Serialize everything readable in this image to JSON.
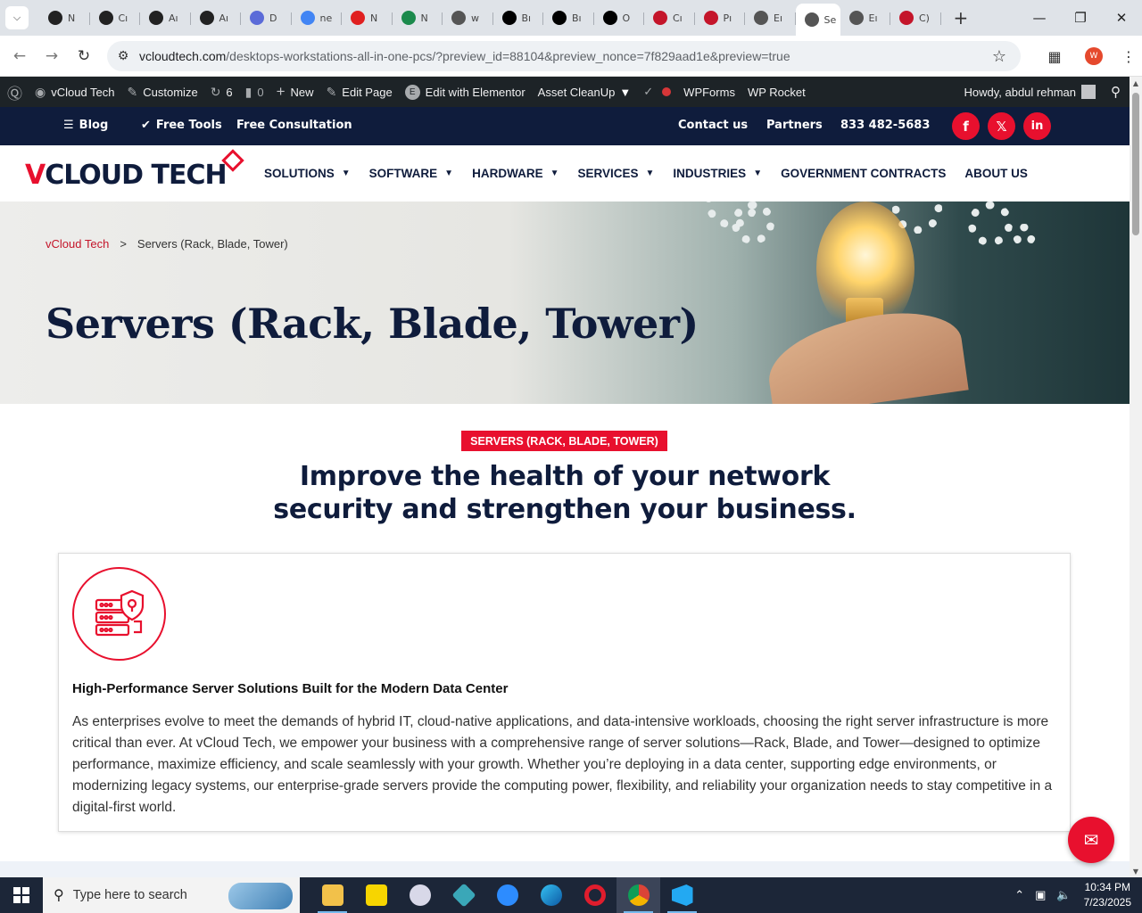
{
  "browser": {
    "tabs": [
      {
        "label": "N",
        "color": "#222"
      },
      {
        "label": "Cı",
        "color": "#222"
      },
      {
        "label": "Aı",
        "color": "#222"
      },
      {
        "label": "Aı",
        "color": "#222"
      },
      {
        "label": "D",
        "color": "#5b6bd8"
      },
      {
        "label": "ne",
        "color": "#4285f4"
      },
      {
        "label": "N",
        "color": "#e02020"
      },
      {
        "label": "N",
        "color": "#1b8a4c"
      },
      {
        "label": "w",
        "color": "#555"
      },
      {
        "label": "Bı",
        "color": "#000"
      },
      {
        "label": "Bı",
        "color": "#000"
      },
      {
        "label": "O",
        "color": "#000"
      },
      {
        "label": "Cı",
        "color": "#c4152a"
      },
      {
        "label": "Pı",
        "color": "#c4152a"
      },
      {
        "label": "Eı",
        "color": "#555"
      },
      {
        "label": "Se",
        "color": "#555"
      },
      {
        "label": "Eı",
        "color": "#555"
      },
      {
        "label": "C)",
        "color": "#c4152a"
      }
    ],
    "url_host": "vcloudtech.com",
    "url_path": "/desktops-workstations-all-in-one-pcs/?preview_id=88104&preview_nonce=7f829aad1e&preview=true",
    "profile_initial": "W"
  },
  "wpbar": {
    "site": "vCloud Tech",
    "customize": "Customize",
    "updates": "6",
    "comments": "0",
    "new": "New",
    "edit_page": "Edit Page",
    "elementor": "Edit with Elementor",
    "asset_cleanup": "Asset CleanUp",
    "wpforms": "WPForms",
    "wprocket": "WP Rocket",
    "howdy": "Howdy, abdul rehman"
  },
  "topbar": {
    "blog": "Blog",
    "free_tools": "Free Tools",
    "free_consultation": "Free Consultation",
    "contact": "Contact us",
    "partners": "Partners",
    "phone": "833 482-5683"
  },
  "logo": {
    "v": "V",
    "rest": "CLOUD TECH"
  },
  "nav": {
    "solutions": "SOLUTIONS",
    "software": "SOFTWARE",
    "hardware": "HARDWARE",
    "services": "SERVICES",
    "industries": "INDUSTRIES",
    "government": "GOVERNMENT CONTRACTS",
    "about": "ABOUT US"
  },
  "hero": {
    "breadcrumb_home": "vCloud Tech",
    "breadcrumb_sep": ">",
    "breadcrumb_current": "Servers (Rack, Blade, Tower)",
    "title": "Servers (Rack, Blade, Tower)"
  },
  "content": {
    "badge": "SERVERS (RACK, BLADE, TOWER)",
    "headline_line1": "Improve the health of your network",
    "headline_line2": "security and strengthen your business.",
    "card_title": "High-Performance Server Solutions Built for the Modern Data Center",
    "card_body": "As enterprises evolve to meet the demands of hybrid IT, cloud-native applications, and data-intensive workloads, choosing the right server infrastructure is more critical than ever. At vCloud Tech, we empower your business with a comprehensive range of server solutions—Rack, Blade, and Tower—designed to optimize performance, maximize efficiency, and scale seamlessly with your growth. Whether you’re deploying in a data center, supporting edge environments, or modernizing legacy systems, our enterprise-grade servers provide the computing power, flexibility, and reliability your organization needs to stay competitive in a digital-first world."
  },
  "taskbar": {
    "search_placeholder": "Type here to search",
    "time": "10:34 PM",
    "date": "7/23/2025"
  },
  "colors": {
    "brand_red": "#e8102e",
    "brand_navy": "#0f1c3c"
  }
}
